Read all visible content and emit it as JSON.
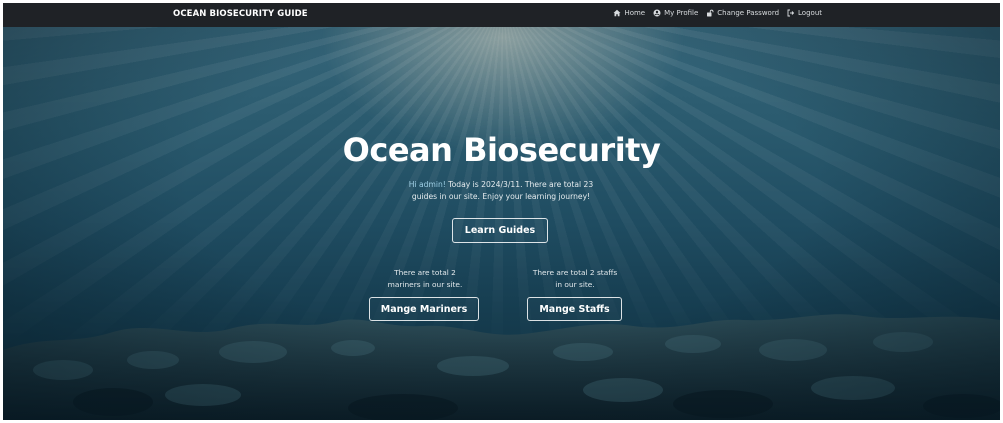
{
  "navbar": {
    "brand": "OCEAN BIOSECURITY GUIDE",
    "links": [
      {
        "label": "Home",
        "icon": "home-icon"
      },
      {
        "label": "My Profile",
        "icon": "user-circle-icon"
      },
      {
        "label": "Change Password",
        "icon": "unlock-icon"
      },
      {
        "label": "Logout",
        "icon": "logout-icon"
      }
    ]
  },
  "hero": {
    "title": "Ocean Biosecurity",
    "welcome_hi": "Hi admin!",
    "welcome_rest_line1": " Today is 2024/3/11. There are total 23",
    "welcome_line2": "guides in our site. Enjoy your learning journey!",
    "learn_button": "Learn Guides"
  },
  "mariners": {
    "count_line1": "There are total 2",
    "count_line2": "mariners in our site.",
    "button": "Mange Mariners"
  },
  "staffs": {
    "count_line1": "There are total 2 staffs",
    "count_line2": "in our site.",
    "button": "Mange Staffs"
  },
  "colors": {
    "navbar_bg": "#1f2226",
    "hero_water": "#1f4c61",
    "accent_hi": "#9fd0e6",
    "button_border": "#ffffff"
  }
}
